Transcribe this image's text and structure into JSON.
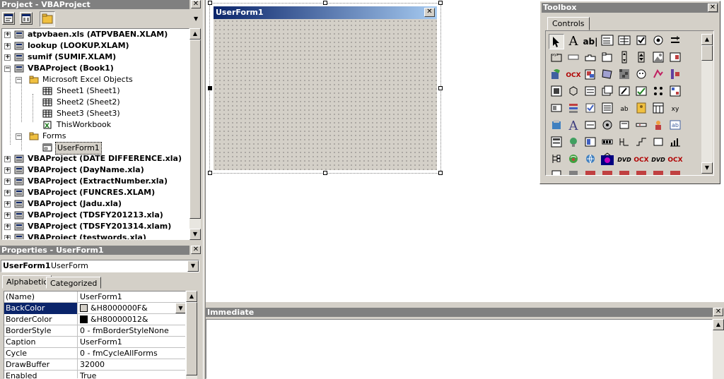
{
  "project": {
    "title": "Project - VBAProject",
    "close": "✕",
    "items": [
      {
        "label": "atpvbaen.xls (ATPVBAEN.XLAM)",
        "exp": "+"
      },
      {
        "label": "lookup (LOOKUP.XLAM)",
        "exp": "+"
      },
      {
        "label": "sumif (SUMIF.XLAM)",
        "exp": "+"
      },
      {
        "label": "VBAProject (Book1)",
        "exp": "−"
      },
      {
        "label": "Microsoft Excel Objects",
        "exp": "−"
      },
      {
        "label": "Sheet1 (Sheet1)"
      },
      {
        "label": "Sheet2 (Sheet2)"
      },
      {
        "label": "Sheet3 (Sheet3)"
      },
      {
        "label": "ThisWorkbook"
      },
      {
        "label": "Forms",
        "exp": "−"
      },
      {
        "label": "UserForm1"
      },
      {
        "label": "VBAProject (DATE DIFFERENCE.xla)",
        "exp": "+"
      },
      {
        "label": "VBAProject (DayName.xla)",
        "exp": "+"
      },
      {
        "label": "VBAProject (ExtractNumber.xla)",
        "exp": "+"
      },
      {
        "label": "VBAProject (FUNCRES.XLAM)",
        "exp": "+"
      },
      {
        "label": "VBAProject (Jadu.xla)",
        "exp": "+"
      },
      {
        "label": "VBAProject (TDSFY201213.xla)",
        "exp": "+"
      },
      {
        "label": "VBAProject (TDSFY201314.xlam)",
        "exp": "+"
      },
      {
        "label": "VBAProject (testwords.xla)",
        "exp": "+"
      }
    ]
  },
  "properties": {
    "title": "Properties - UserForm1",
    "close": "✕",
    "object_name": "UserForm1",
    "object_type": "UserForm",
    "tabs": [
      "Alphabetic",
      "Categorized"
    ],
    "rows": [
      {
        "name": "(Name)",
        "value": "UserForm1"
      },
      {
        "name": "BackColor",
        "value": "&H8000000F&",
        "swatch": "#d4d0c8"
      },
      {
        "name": "BorderColor",
        "value": "&H80000012&",
        "swatch": "#000000"
      },
      {
        "name": "BorderStyle",
        "value": "0 - fmBorderStyleNone"
      },
      {
        "name": "Caption",
        "value": "UserForm1"
      },
      {
        "name": "Cycle",
        "value": "0 - fmCycleAllForms"
      },
      {
        "name": "DrawBuffer",
        "value": "32000"
      },
      {
        "name": "Enabled",
        "value": "True"
      }
    ]
  },
  "userform": {
    "title": "UserForm1",
    "close": "✕"
  },
  "toolbox": {
    "title": "Toolbox",
    "close": "✕",
    "tab": "Controls",
    "text_tools": {
      "label_tool": "A",
      "textbox_tool": "ab|",
      "ocx1": "OCX",
      "label_tool2": "A",
      "ab_button": "ab",
      "xy_tool": "xy",
      "dvd1": "DVD",
      "ocx2": "OCX",
      "dvd2": "DVD",
      "ocx3": "OCX"
    }
  },
  "immediate": {
    "title": "Immediate",
    "close": "✕"
  },
  "colors": {
    "selection": "#0a246a",
    "title_active": "#0a246a",
    "panel": "#d4d0c8"
  }
}
